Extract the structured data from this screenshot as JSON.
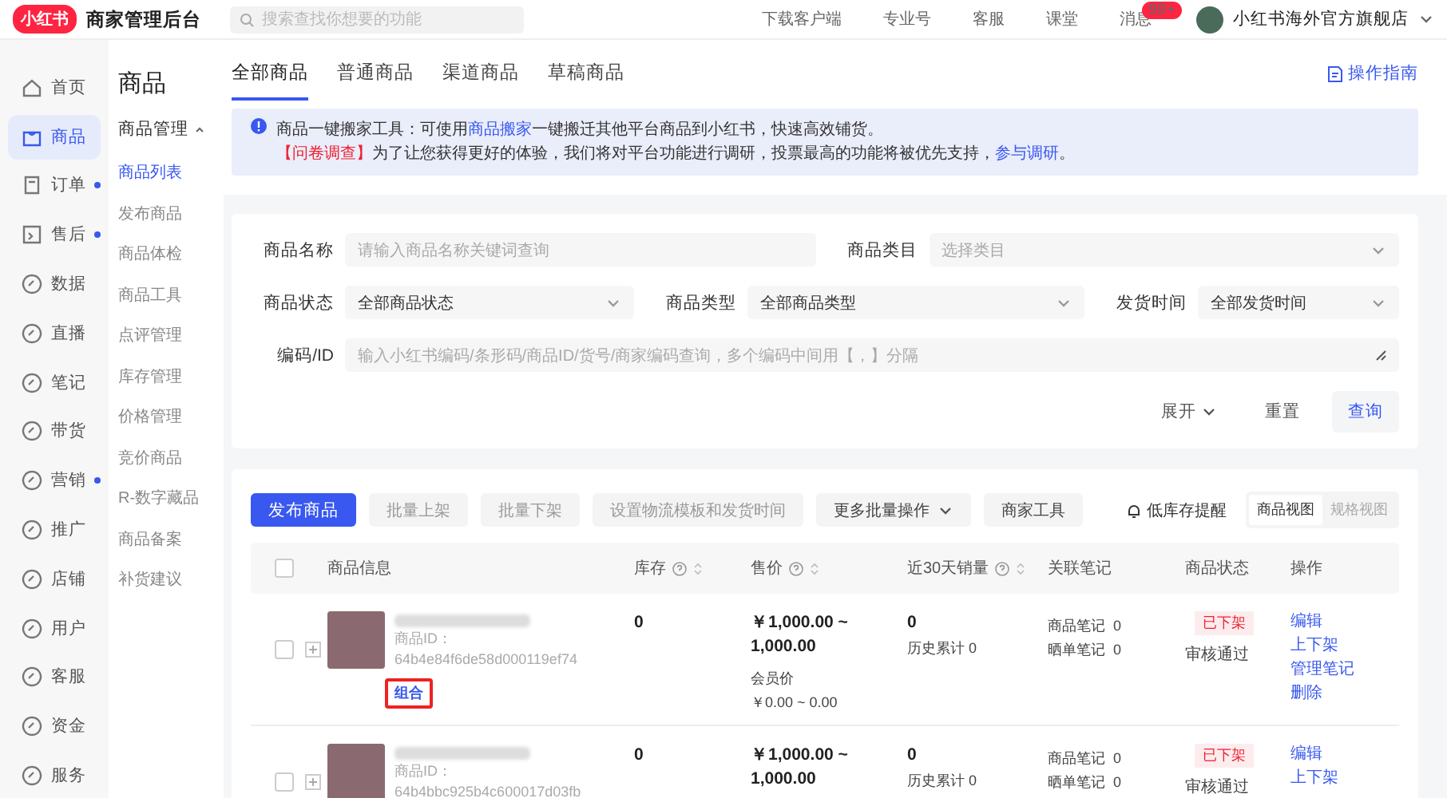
{
  "topbar": {
    "logo": "小红书",
    "title": "商家管理后台",
    "search": {
      "placeholder": "搜索查找你想要的功能"
    },
    "links": [
      "下载客户端",
      "专业号",
      "客服",
      "课堂"
    ],
    "messages": {
      "label": "消息",
      "badge": "99+"
    },
    "shop": "小红书海外官方旗舰店"
  },
  "nav": [
    {
      "label": "首页",
      "selected": false,
      "dot": false
    },
    {
      "label": "商品",
      "selected": true,
      "dot": false
    },
    {
      "label": "订单",
      "selected": false,
      "dot": true
    },
    {
      "label": "售后",
      "selected": false,
      "dot": true
    },
    {
      "label": "数据",
      "selected": false,
      "dot": false
    },
    {
      "label": "直播",
      "selected": false,
      "dot": false
    },
    {
      "label": "笔记",
      "selected": false,
      "dot": false
    },
    {
      "label": "带货",
      "selected": false,
      "dot": false
    },
    {
      "label": "营销",
      "selected": false,
      "dot": true
    },
    {
      "label": "推广",
      "selected": false,
      "dot": false
    },
    {
      "label": "店铺",
      "selected": false,
      "dot": false
    },
    {
      "label": "用户",
      "selected": false,
      "dot": false
    },
    {
      "label": "客服",
      "selected": false,
      "dot": false
    },
    {
      "label": "资金",
      "selected": false,
      "dot": false
    },
    {
      "label": "服务",
      "selected": false,
      "dot": false
    }
  ],
  "subnav": {
    "title": "商品",
    "group": {
      "label": "商品管理",
      "expanded": true
    },
    "items": [
      {
        "label": "商品列表",
        "selected": true
      },
      {
        "label": "发布商品",
        "selected": false
      },
      {
        "label": "商品体检",
        "selected": false
      },
      {
        "label": "商品工具",
        "selected": false
      },
      {
        "label": "点评管理",
        "selected": false
      },
      {
        "label": "库存管理",
        "selected": false
      },
      {
        "label": "价格管理",
        "selected": false
      },
      {
        "label": "竞价商品",
        "selected": false
      },
      {
        "label": "R-数字藏品",
        "selected": false
      },
      {
        "label": "商品备案",
        "selected": false
      },
      {
        "label": "补货建议",
        "selected": false
      }
    ]
  },
  "tabs": [
    {
      "label": "全部商品",
      "selected": true
    },
    {
      "label": "普通商品",
      "selected": false
    },
    {
      "label": "渠道商品",
      "selected": false
    },
    {
      "label": "草稿商品",
      "selected": false
    }
  ],
  "guide": "操作指南",
  "notice": {
    "line_1": {
      "before": "商品一键搬家工具：可使用",
      "link": "商品搬家",
      "after": "一键搬迁其他平台商品到小红书，快速高效铺货。"
    },
    "line_2": {
      "tag": "【问卷调查】",
      "text": "为了让您获得更好的体验，我们将对平台功能进行调研，投票最高的功能将被优先支持，",
      "link": "参与调研",
      "end": "。"
    }
  },
  "filters": {
    "rows": [
      [
        {
          "kind": "text",
          "label": "商品名称",
          "placeholder": "请输入商品名称关键词查询"
        },
        {
          "kind": "select",
          "label": "商品类目",
          "placeholder": "选择类目"
        }
      ],
      [
        {
          "kind": "select",
          "label": "商品状态",
          "value": "全部商品状态"
        },
        {
          "kind": "select",
          "label": "商品类型",
          "value": "全部商品类型"
        },
        {
          "kind": "select",
          "label": "发货时间",
          "value": "全部发货时间"
        }
      ],
      [
        {
          "kind": "textarea",
          "label": "编码/ID",
          "placeholder": "输入小红书编码/条形码/商品ID/货号/商家编码查询，多个编码中间用【，】分隔"
        }
      ]
    ],
    "expand": "展开",
    "reset": "重置",
    "search": "查询"
  },
  "toolbar": {
    "buttons": [
      {
        "kind": "primary",
        "label": "发布商品",
        "disabled": false
      },
      {
        "kind": "plain",
        "label": "批量上架",
        "disabled": true
      },
      {
        "kind": "plain",
        "label": "批量下架",
        "disabled": true
      },
      {
        "kind": "plain",
        "label": "设置物流模板和发货时间",
        "disabled": true
      },
      {
        "kind": "dropdown",
        "label": "更多批量操作",
        "disabled": false
      },
      {
        "kind": "plain",
        "label": "商家工具",
        "disabled": false
      }
    ],
    "low_stock": "低库存提醒",
    "views": [
      {
        "label": "商品视图",
        "selected": true
      },
      {
        "label": "规格视图",
        "selected": false
      }
    ]
  },
  "table": {
    "select_all_checked": false,
    "columns": [
      {
        "label": "商品信息",
        "help": false,
        "sortable": false
      },
      {
        "label": "库存",
        "help": true,
        "sortable": true
      },
      {
        "label": "售价",
        "help": true,
        "sortable": true
      },
      {
        "label": "近30天销量",
        "help": true,
        "sortable": true
      },
      {
        "label": "关联笔记",
        "help": false,
        "sortable": false
      },
      {
        "label": "商品状态",
        "help": false,
        "sortable": false
      },
      {
        "label": "操作",
        "help": false,
        "sortable": false
      }
    ],
    "rows": [
      {
        "checked": false,
        "id_label": "商品ID：",
        "id": "64b4e84f6de58d000119ef74",
        "tag": "组合",
        "stock": "0",
        "price": [
          "￥1,000.00 ~",
          "1,000.00"
        ],
        "member_price": {
          "label": "会员价",
          "value": "￥0.00 ~ 0.00"
        },
        "sales": "0",
        "history": "历史累计 0",
        "notes": [
          "商品笔记  0",
          "晒单笔记  0"
        ],
        "status": "已下架",
        "audit": "审核通过",
        "actions": [
          "编辑",
          "上下架",
          "管理笔记",
          "删除"
        ]
      },
      {
        "checked": false,
        "id_label": "商品ID：",
        "id": "64b4bbc925b4c600017d03fb",
        "stock": "0",
        "price": [
          "￥1,000.00 ~",
          "1,000.00"
        ],
        "sales": "0",
        "history": "历史累计 0",
        "notes": [
          "商品笔记  0",
          "晒单笔记  0"
        ],
        "status": "已下架",
        "audit": "审核通过",
        "actions": [
          "编辑",
          "上下架"
        ]
      }
    ]
  }
}
